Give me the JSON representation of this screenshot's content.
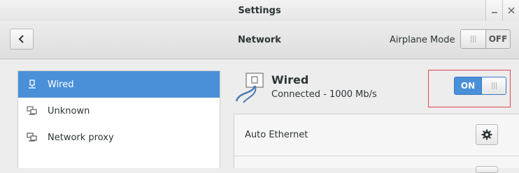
{
  "window": {
    "title": "Settings"
  },
  "header": {
    "title": "Network",
    "airplane_mode_label": "Airplane Mode",
    "airplane_mode_state": "OFF"
  },
  "sidebar": {
    "items": [
      {
        "label": "Wired",
        "icon": "wired-network-icon",
        "selected": true
      },
      {
        "label": "Unknown",
        "icon": "network-device-icon",
        "selected": false
      },
      {
        "label": "Network proxy",
        "icon": "network-proxy-icon",
        "selected": false
      }
    ]
  },
  "detail": {
    "title": "Wired",
    "status": "Connected - 1000 Mb/s",
    "toggle_state": "ON",
    "profiles": [
      {
        "name": "Auto Ethernet",
        "icon": "gear-icon"
      }
    ]
  },
  "colors": {
    "accent": "#4a90d9",
    "highlight_border": "#e0454d"
  }
}
